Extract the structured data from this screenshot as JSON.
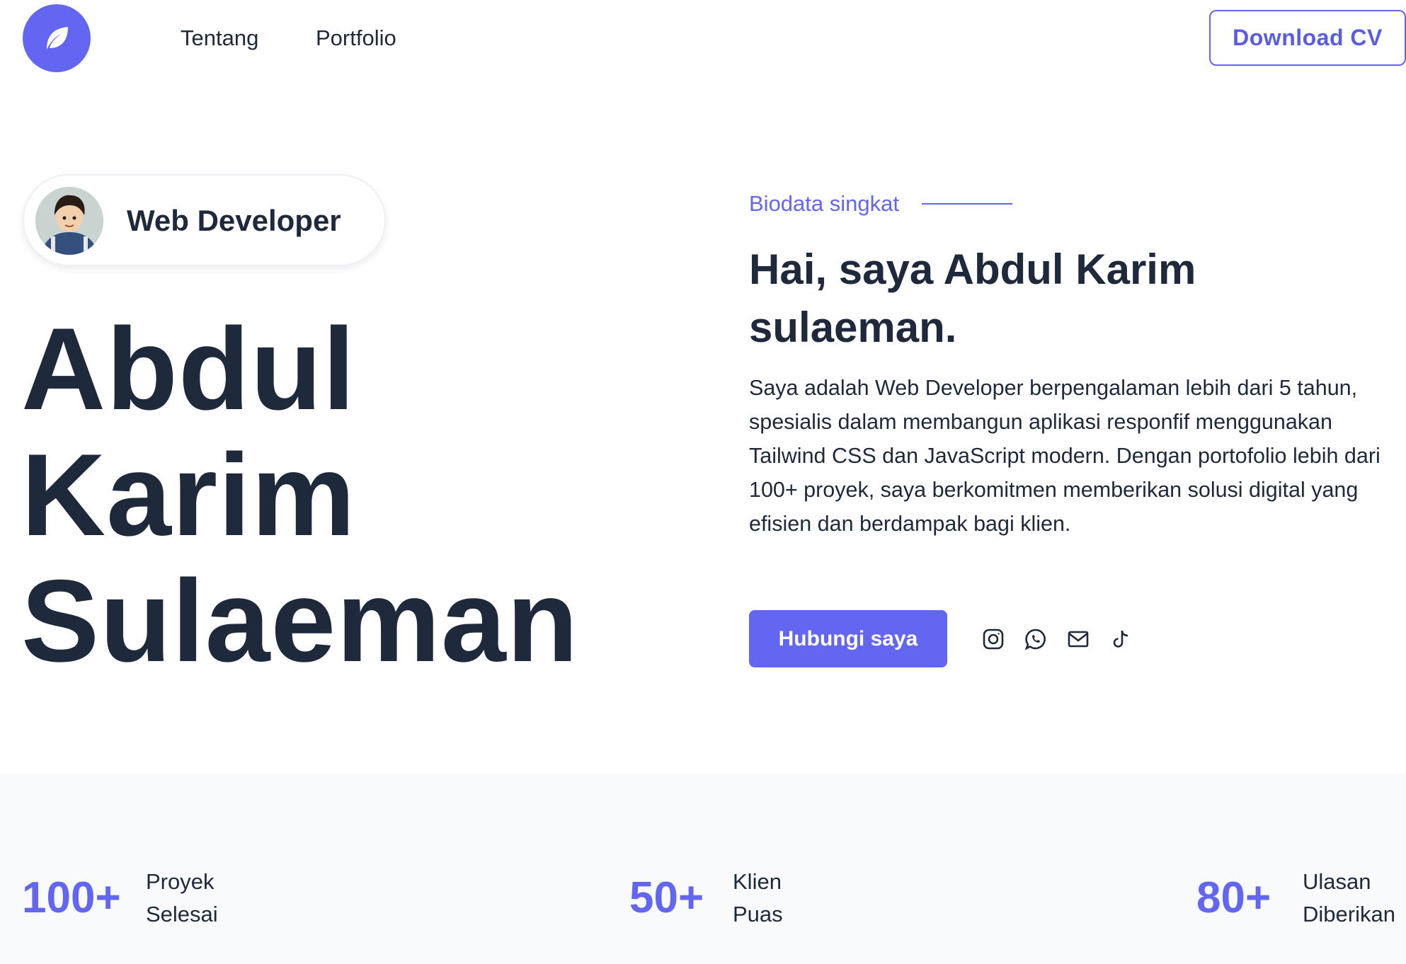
{
  "header": {
    "logo_icon": "leaf-icon",
    "nav": [
      {
        "label": "Tentang"
      },
      {
        "label": "Portfolio"
      }
    ],
    "cv_button": "Download CV"
  },
  "hero": {
    "role": "Web Developer",
    "name_lines": [
      "Abdul",
      "Karim",
      "Sulaeman"
    ]
  },
  "about": {
    "label": "Biodata singkat",
    "title_line1": "Hai, saya Abdul Karim",
    "title_line2": "sulaeman.",
    "paragraph": "Saya adalah Web Developer berpengalaman lebih dari 5 tahun, spesialis dalam membangun aplikasi responfif menggunakan Tailwind CSS dan JavaScript modern. Dengan portofolio lebih dari 100+ proyek, saya berkomitmen memberikan solusi digital yang efisien dan berdampak bagi klien.",
    "contact_button": "Hubungi saya",
    "socials": [
      "instagram-icon",
      "whatsapp-icon",
      "mail-icon",
      "tiktok-icon"
    ]
  },
  "stats": [
    {
      "value": "100+",
      "line1": "Proyek",
      "line2": "Selesai"
    },
    {
      "value": "50+",
      "line1": "Klien",
      "line2": "Puas"
    },
    {
      "value": "80+",
      "line1": "Ulasan",
      "line2": "Diberikan"
    }
  ],
  "colors": {
    "accent": "#6366f1",
    "text": "#1e293b",
    "stats_bg": "#f8fafc"
  }
}
